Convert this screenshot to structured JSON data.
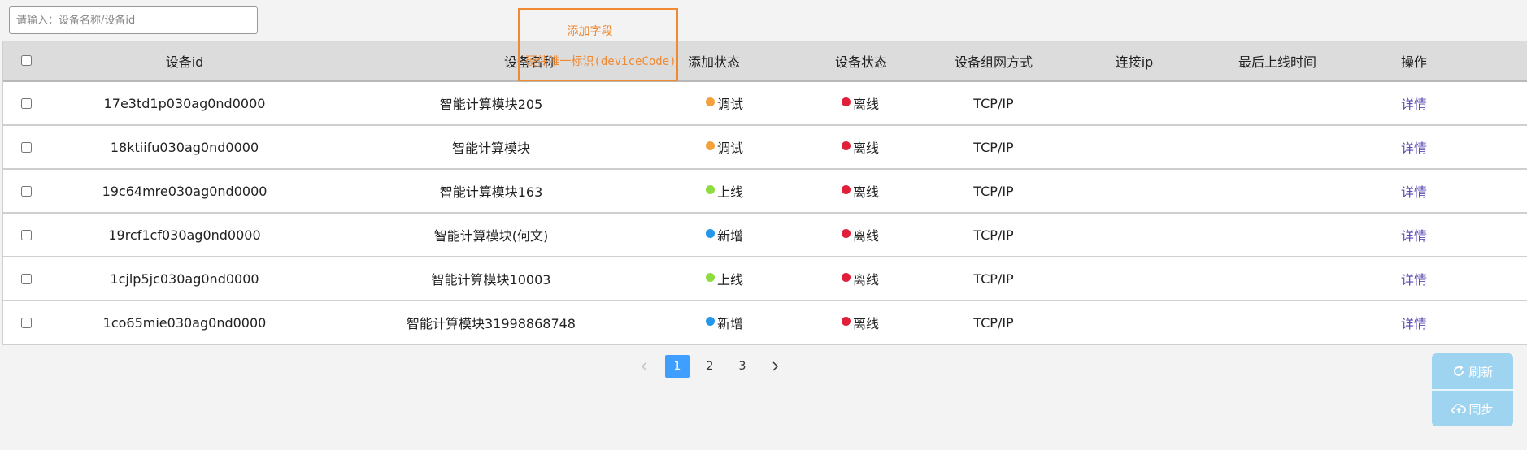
{
  "search": {
    "placeholder": "请输入：设备名称/设备id",
    "value": ""
  },
  "annotation": {
    "label": "添加字段"
  },
  "table": {
    "headers": {
      "device_id": "设备id",
      "device_name": "设备名称",
      "hardware_id": "硬件唯一标识(deviceCode)",
      "add_status": "添加状态",
      "device_status": "设备状态",
      "network_mode": "设备组网方式",
      "connect_ip": "连接ip",
      "last_online": "最后上线时间",
      "action": "操作"
    },
    "rows": [
      {
        "id": "17e3td1p030ag0nd0000",
        "name": "智能计算模块205",
        "add_status": "调试",
        "add_color": "#f5a03a",
        "status": "离线",
        "status_color": "#e0203a",
        "network": "TCP/IP",
        "action": "详情"
      },
      {
        "id": "18ktiifu030ag0nd0000",
        "name": "智能计算模块",
        "add_status": "调试",
        "add_color": "#f5a03a",
        "status": "离线",
        "status_color": "#e0203a",
        "network": "TCP/IP",
        "action": "详情"
      },
      {
        "id": "19c64mre030ag0nd0000",
        "name": "智能计算模块163",
        "add_status": "上线",
        "add_color": "#8fdc3f",
        "status": "离线",
        "status_color": "#e0203a",
        "network": "TCP/IP",
        "action": "详情"
      },
      {
        "id": "19rcf1cf030ag0nd0000",
        "name": "智能计算模块(何文)",
        "add_status": "新增",
        "add_color": "#2596e8",
        "status": "离线",
        "status_color": "#e0203a",
        "network": "TCP/IP",
        "action": "详情"
      },
      {
        "id": "1cjlp5jc030ag0nd0000",
        "name": "智能计算模块10003",
        "add_status": "上线",
        "add_color": "#8fdc3f",
        "status": "离线",
        "status_color": "#e0203a",
        "network": "TCP/IP",
        "action": "详情"
      },
      {
        "id": "1co65mie030ag0nd0000",
        "name": "智能计算模块31998868748",
        "add_status": "新增",
        "add_color": "#2596e8",
        "status": "离线",
        "status_color": "#e0203a",
        "network": "TCP/IP",
        "action": "详情"
      }
    ]
  },
  "pagination": {
    "pages": [
      "1",
      "2",
      "3"
    ],
    "current": "1"
  },
  "fab": {
    "refresh_label": "刷新",
    "sync_label": "同步"
  }
}
